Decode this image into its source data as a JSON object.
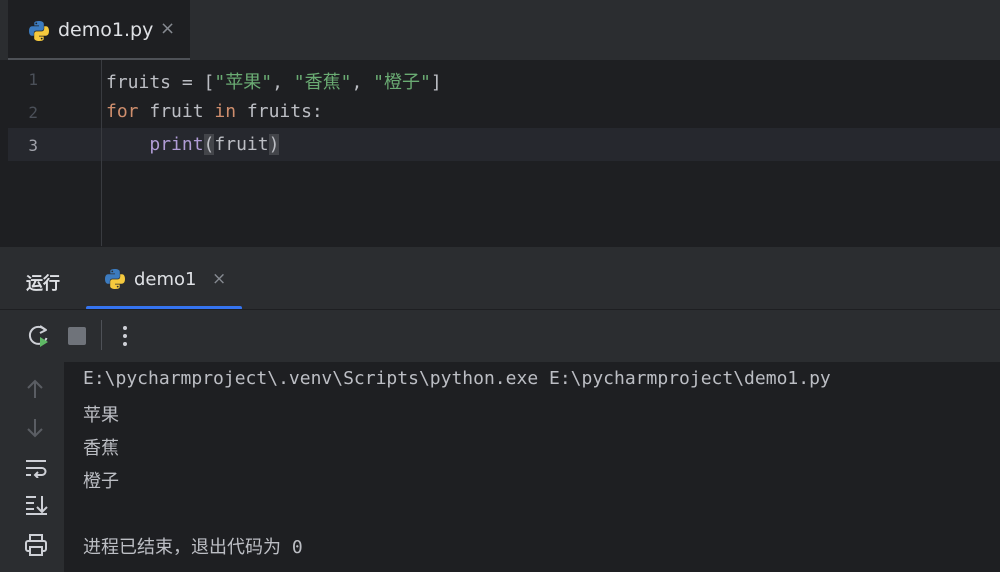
{
  "editor": {
    "tab": {
      "label": "demo1.py",
      "close": "×"
    },
    "line_numbers": [
      "1",
      "2",
      "3"
    ],
    "lines": [
      {
        "var": "fruits",
        "eq": " = [",
        "s1": "\"苹果\"",
        "comma1": ", ",
        "s2": "\"香蕉\"",
        "comma2": ", ",
        "s3": "\"橙子\"",
        "close": "]"
      },
      {
        "kw_for": "for",
        "mid1": " fruit ",
        "kw_in": "in",
        "mid2": " fruits:"
      },
      {
        "indent": "    ",
        "fn": "print",
        "open": "(",
        "arg": "fruit",
        "close": ")"
      }
    ]
  },
  "run": {
    "title": "运行",
    "tab": {
      "label": "demo1",
      "close": "×"
    },
    "console": [
      "E:\\pycharmproject\\.venv\\Scripts\\python.exe E:\\pycharmproject\\demo1.py",
      "苹果",
      "香蕉",
      "橙子",
      "",
      "进程已结束，退出代码为 0"
    ]
  },
  "colors": {
    "background": "#1e1f22",
    "panel": "#2b2d30",
    "accent": "#3574f0",
    "keyword": "#cf8e6d",
    "string": "#6aab73",
    "function": "#b09cd6",
    "rerun_green": "#5fb865"
  },
  "icons": {
    "editor_tab": "python-icon",
    "run_tab": "python-icon",
    "toolbar": [
      "rerun-icon",
      "stop-icon",
      "more-vertical-icon"
    ],
    "sidebar": [
      "arrow-up-icon",
      "arrow-down-icon",
      "soft-wrap-icon",
      "scroll-to-end-icon",
      "print-icon"
    ]
  }
}
